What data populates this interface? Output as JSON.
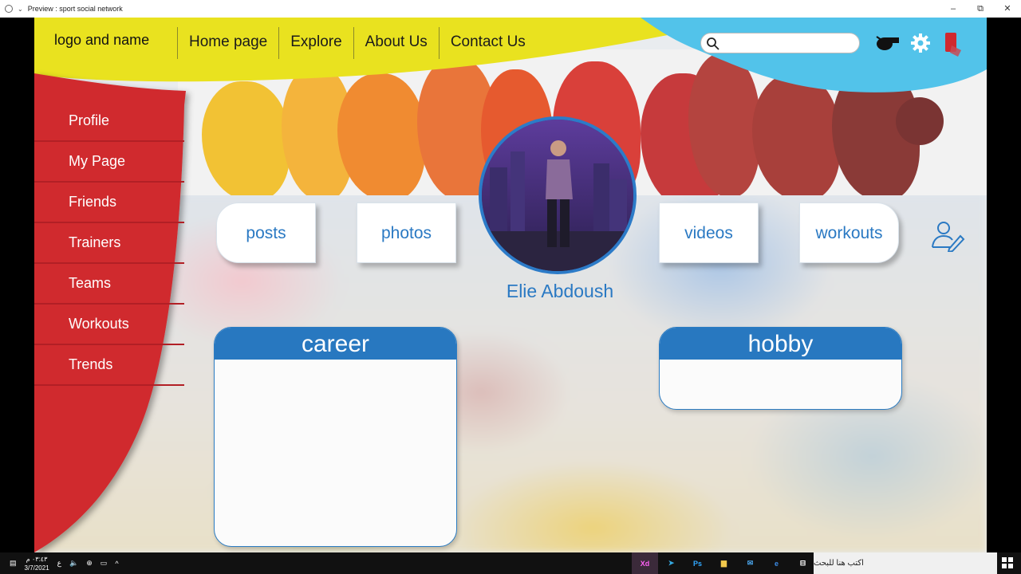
{
  "window": {
    "title": "Preview : sport social network",
    "min_glyph": "–",
    "max_glyph": "⧉",
    "close_glyph": "✕"
  },
  "header": {
    "brand": "logo and name",
    "nav": [
      "Home page",
      "Explore",
      "About Us",
      "Contact Us"
    ],
    "search": {
      "value": "",
      "placeholder": ""
    },
    "icons": [
      "whistle-icon",
      "gear-icon",
      "logout-icon"
    ]
  },
  "sidebar": {
    "items": [
      "Profile",
      "My Page",
      "Friends",
      "Trainers",
      "Teams",
      "Workouts",
      "Trends"
    ]
  },
  "profile": {
    "name": "Elie Abdoush",
    "tabs": [
      "posts",
      "photos",
      "videos",
      "workouts"
    ],
    "edit_icon": "edit-profile-icon"
  },
  "cards": {
    "career": {
      "title": "career"
    },
    "hobby": {
      "title": "hobby"
    }
  },
  "taskbar": {
    "time": "٠٣:٤٣ م",
    "date": "3/7/2021",
    "lang": "ع",
    "apps": [
      "Xd",
      "Telegram",
      "Ps",
      "Explorer",
      "Mail",
      "Edge",
      "Task"
    ],
    "search_placeholder": "اكتب هنا للبحث"
  },
  "colors": {
    "header_yellow": "#e9e21f",
    "header_cyan": "#52c3ea",
    "sidebar_red": "#d0292f",
    "accent_blue": "#2878c0"
  }
}
